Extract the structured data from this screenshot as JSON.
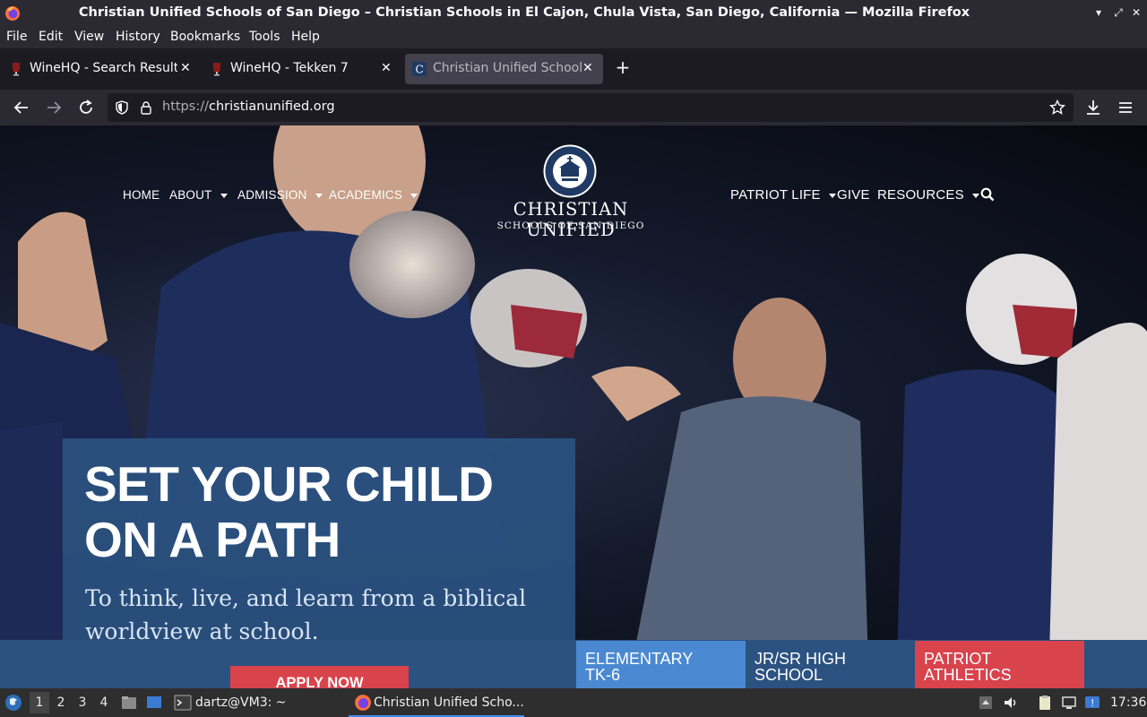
{
  "window": {
    "title": "Christian Unified Schools of San Diego – Christian Schools in El Cajon, Chula Vista, San Diego, California — Mozilla Firefox"
  },
  "menubar": {
    "items": [
      "File",
      "Edit",
      "View",
      "History",
      "Bookmarks",
      "Tools",
      "Help"
    ]
  },
  "tabs": [
    {
      "label": "WineHQ - Search Results",
      "active": false
    },
    {
      "label": "WineHQ - Tekken 7",
      "active": false
    },
    {
      "label": "Christian Unified Schools",
      "active": true
    }
  ],
  "urlbar": {
    "protocol": "https://",
    "host": "christianunified.org"
  },
  "site": {
    "nav_left": [
      "HOME",
      "ABOUT",
      "ADMISSION",
      "ACADEMICS"
    ],
    "nav_right": [
      "PATRIOT LIFE",
      "GIVE",
      "RESOURCES"
    ],
    "logo_name": "CHRISTIAN UNIFIED",
    "logo_sub": "SCHOOLS OF SAN DIEGO",
    "hero_title_line1": "SET YOUR CHILD",
    "hero_title_line2": "ON A PATH",
    "hero_subtitle": "To think, live, and learn from a biblical worldview at school.",
    "apply_label": "APPLY NOW",
    "school_tiles": [
      {
        "line1": "ELEMENTARY",
        "line2": "TK-6",
        "color": "#4a89d1"
      },
      {
        "line1": "JR/SR HIGH",
        "line2": "SCHOOL",
        "color": "#2b5280"
      },
      {
        "line1": "PATRIOT",
        "line2": "ATHLETICS",
        "color": "#d9434c"
      }
    ]
  },
  "taskbar": {
    "workspaces": [
      "1",
      "2",
      "3",
      "4"
    ],
    "terminal_label": "dartz@VM3: ~",
    "firefox_label": "Christian Unified Scho...",
    "clock": "17:36"
  }
}
